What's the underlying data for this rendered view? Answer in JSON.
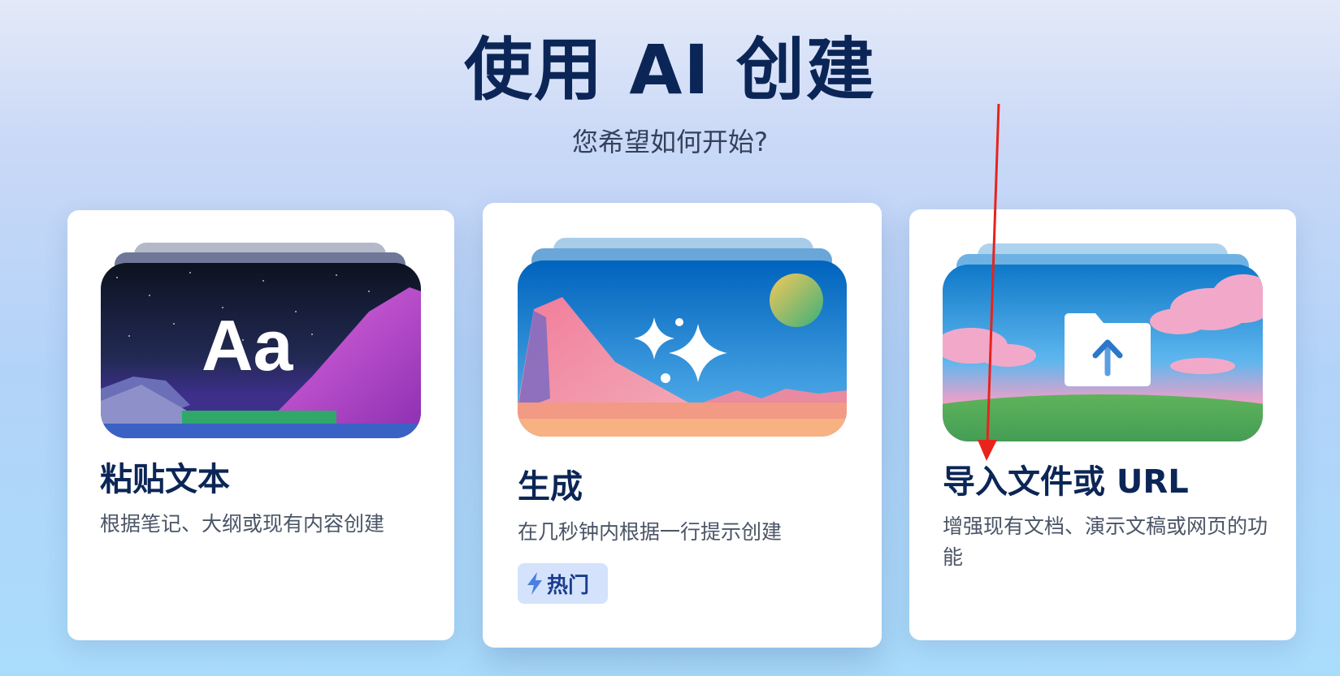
{
  "header": {
    "title": "使用 AI 创建",
    "subtitle": "您希望如何开始?"
  },
  "cards": [
    {
      "title": "粘贴文本",
      "description": "根据笔记、大纲或现有内容创建",
      "art_text": "Aa",
      "icon": "text-aa-icon"
    },
    {
      "title": "生成",
      "description": "在几秒钟内根据一行提示创建",
      "badge": "热门",
      "badge_icon": "lightning-icon",
      "icon": "sparkle-icon"
    },
    {
      "title": "导入文件或 URL",
      "description": "增强现有文档、演示文稿或网页的功能",
      "icon": "folder-upload-icon"
    }
  ],
  "colors": {
    "title": "#0b2656",
    "badge_bg": "#d4e2fb",
    "badge_text": "#1a3d8f",
    "annotation_arrow": "#e8231c"
  }
}
